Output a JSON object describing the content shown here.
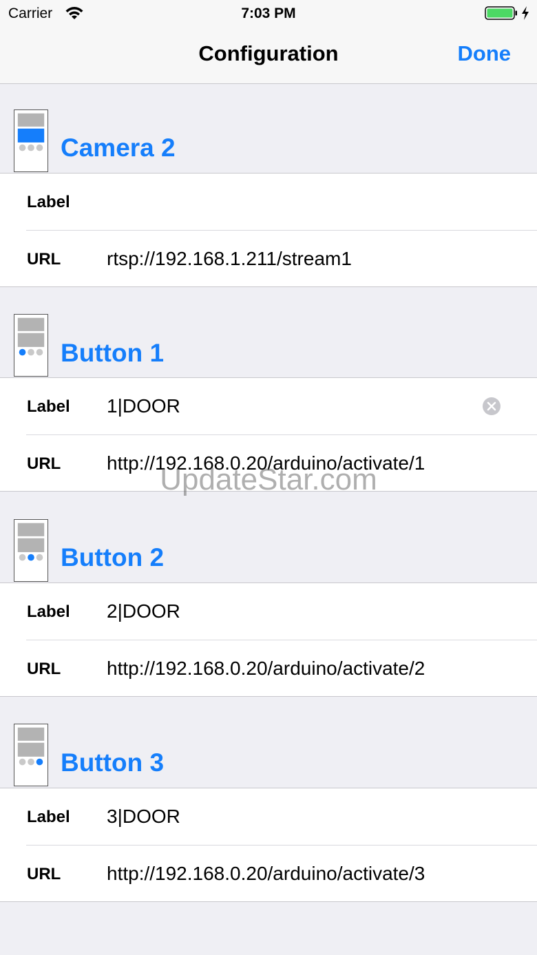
{
  "status_bar": {
    "carrier": "Carrier",
    "time": "7:03 PM",
    "wifi_icon": "wifi-icon",
    "battery_icon": "battery-icon",
    "charging_icon": "lightning-bolt-icon",
    "battery_color": "#4cd964"
  },
  "navbar": {
    "title": "Configuration",
    "done_label": "Done"
  },
  "colors": {
    "accent": "#157efb",
    "background": "#efeff4",
    "separator": "#c8c7cc",
    "icon_gray": "#b3b3b3",
    "icon_dot_gray": "#c9c9c9"
  },
  "sections": [
    {
      "title": "Camera 2",
      "icon": "camera-layout-icon",
      "fields": [
        {
          "label": "Label",
          "value": ""
        },
        {
          "label": "URL",
          "value": "rtsp://192.168.1.211/stream1"
        }
      ]
    },
    {
      "title": "Button 1",
      "icon": "button-layout-icon",
      "fields": [
        {
          "label": "Label",
          "value": "1|DOOR"
        },
        {
          "label": "URL",
          "value": "http://192.168.0.20/arduino/activate/1"
        }
      ]
    },
    {
      "title": "Button 2",
      "icon": "button-layout-icon",
      "fields": [
        {
          "label": "Label",
          "value": "2|DOOR"
        },
        {
          "label": "URL",
          "value": "http://192.168.0.20/arduino/activate/2"
        }
      ]
    },
    {
      "title": "Button 3",
      "icon": "button-layout-icon",
      "fields": [
        {
          "label": "Label",
          "value": "3|DOOR"
        },
        {
          "label": "URL",
          "value": "http://192.168.0.20/arduino/activate/3"
        }
      ]
    }
  ],
  "watermark": "UpdateStar.com"
}
